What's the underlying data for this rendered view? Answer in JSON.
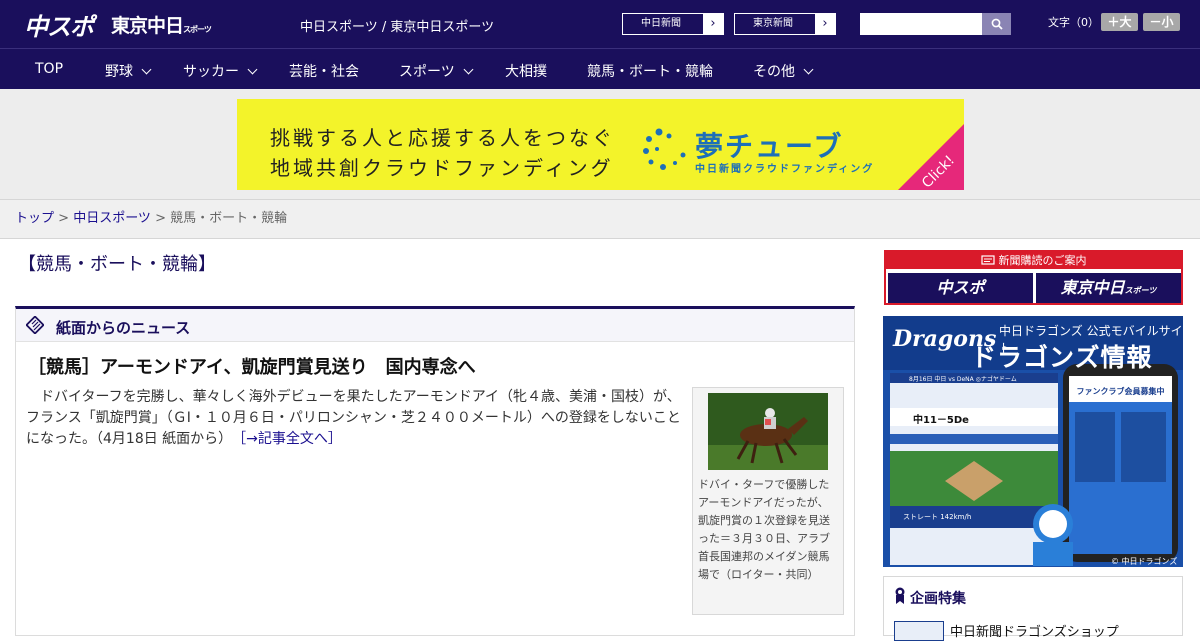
{
  "header": {
    "logo_chuspo": "中スポ",
    "logo_tokyo": "東京中日",
    "logo_tokyo_small": "スポーツ",
    "site_title": "中日スポーツ / 東京中日スポーツ",
    "link_chunichi": "中日新聞",
    "link_tokyo": "東京新聞",
    "link_arrow": "›",
    "search_placeholder": "",
    "search_icon": "search-icon",
    "fontsize_label": "文字（0）",
    "font_larger": "＋大",
    "font_smaller": "－小"
  },
  "nav": {
    "items": [
      {
        "label": "TOP"
      },
      {
        "label": "野球"
      },
      {
        "label": "サッカー"
      },
      {
        "label": "芸能・社会"
      },
      {
        "label": "スポーツ"
      },
      {
        "label": "大相撲"
      },
      {
        "label": "競馬・ボート・競輪"
      },
      {
        "label": "その他"
      }
    ]
  },
  "banner": {
    "line1": "挑戦する人と応援する人をつなぐ",
    "line2": "地域共創クラウドファンディング",
    "brand": "夢チューブ",
    "sub": "中日新聞クラウドファンディング",
    "click": "Click!",
    "colors": {
      "background": "#f3f32a",
      "brand": "#1d6fb8",
      "click": "#e6287a"
    }
  },
  "breadcrumb": {
    "home": "トップ",
    "sep": " > ",
    "section": "中日スポーツ",
    "current": "競馬・ボート・競輪"
  },
  "main": {
    "heading": "【競馬・ボート・競輪】",
    "section_label": "紙面からのニュース",
    "article": {
      "title": "［競馬］アーモンドアイ、凱旋門賞見送り　国内専念へ",
      "body": "ドバイターフを完勝し、華々しく海外デビューを果たしたアーモンドアイ（牝４歳、美浦・国枝）が、フランス「凱旋門賞」（ＧⅠ・１０月６日・パリロンシャン・芝２４００メートル）への登録をしないことになった。（4月18日 紙面から）",
      "more_link": "［→記事全文へ］",
      "caption": "ドバイ・ターフで優勝したアーモンドアイだったが、凱旋門賞の１次登録を見送った＝３月３０日、アラブ首長国連邦のメイダン競馬場で（ロイター・共同）"
    }
  },
  "sidebar": {
    "subscribe_head": "新聞購読のご案内",
    "subscribe_btn1": "中スポ",
    "subscribe_btn2": "東京中日",
    "subscribe_btn2_small": "スポーツ",
    "dragons": {
      "logo": "Dragons",
      "tagline": "中日ドラゴンズ 公式モバイルサイト",
      "title": "ドラゴンズ情報",
      "game_header": "8月16日 中日 vs DeNA ◎ナゴヤドーム",
      "score": "中11－5De",
      "pitch": "ストレート 142km/h",
      "members": "ファンクラブ会員募集中",
      "copyright": "© 中日ドラゴンズ"
    },
    "special_title": "企画特集",
    "special_item": "中日新聞ドラゴンズショップ"
  }
}
